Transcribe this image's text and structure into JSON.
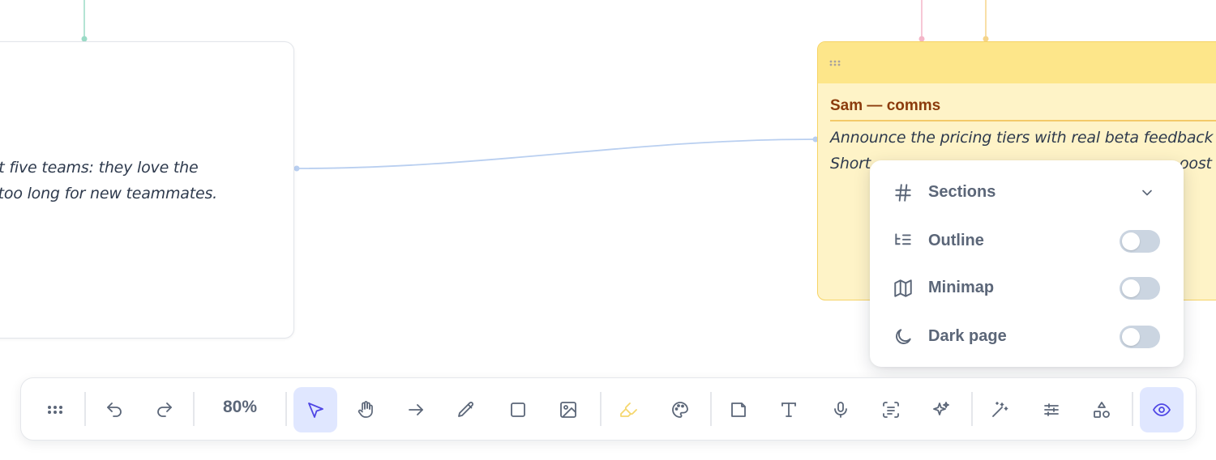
{
  "left_card": {
    "line1": "rst five teams: they love the",
    "line2": "k too long for new teammates."
  },
  "sam_card": {
    "title": "Sam — comms",
    "line1": "Announce the pricing tiers with real beta feedback",
    "line2": "Short",
    "line2_tail": "oost"
  },
  "popover": {
    "sections_label": "Sections",
    "outline_label": "Outline",
    "minimap_label": "Minimap",
    "darkpage_label": "Dark page",
    "outline_on": false,
    "minimap_on": false,
    "darkpage_on": false
  },
  "toolbar": {
    "zoom": "80%",
    "active_tool": "select",
    "icons": [
      "drag-handle-icon",
      "undo-icon",
      "redo-icon",
      "select-cursor-icon",
      "hand-icon",
      "arrow-icon",
      "pencil-icon",
      "rectangle-icon",
      "image-icon",
      "highlighter-icon",
      "palette-icon",
      "sticky-note-icon",
      "text-icon",
      "microphone-icon",
      "scan-text-icon",
      "sparkles-icon",
      "magic-wand-icon",
      "sliders-icon",
      "shapes-icon",
      "eye-icon"
    ]
  },
  "colors": {
    "accent": "#6366f1",
    "active_bg": "#e0e7ff",
    "sticky_bg": "#fef3c7",
    "sticky_header": "#fde68a",
    "sticky_title": "#8b3b0c",
    "connector": "#b9cff0",
    "teal_wire": "#9adbc6",
    "pink_wire": "#f4b6c8",
    "yellow_wire": "#f5d48a"
  }
}
